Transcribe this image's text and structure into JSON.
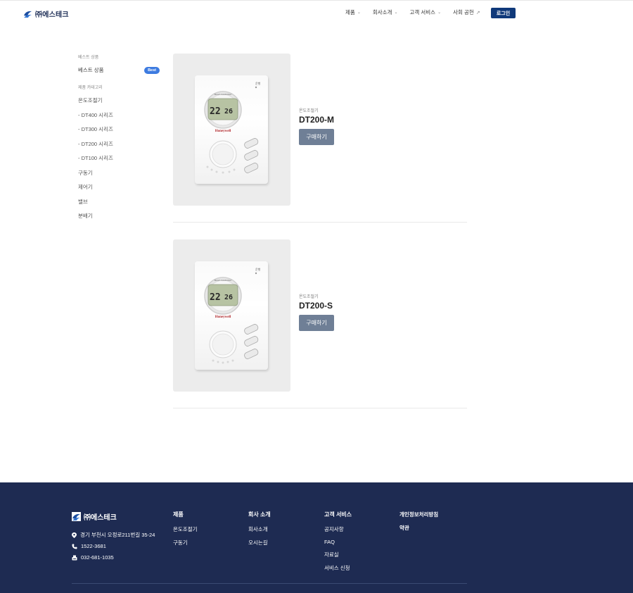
{
  "header": {
    "logo_text": "㈜에스테크",
    "nav": [
      {
        "label": "제품",
        "suffix": "⌄"
      },
      {
        "label": "회사소개",
        "suffix": "⌄"
      },
      {
        "label": "고객 서비스",
        "suffix": "⌄"
      },
      {
        "label": "사회 공헌",
        "suffix": "↗"
      }
    ],
    "login_label": "로그인"
  },
  "sidebar": {
    "best_section": "베스트 상품",
    "best_item": "베스트 상품",
    "best_badge": "Best",
    "category_section": "제품 카테고리",
    "items": [
      "온도조절기",
      "- DT400 시리즈",
      "- DT300 시리즈",
      "- DT200 시리즈",
      "- DT100 시리즈",
      "구동기",
      "제어기",
      "밸브",
      "분배기"
    ]
  },
  "products": [
    {
      "category": "온도조절기",
      "name": "DT200-M",
      "button": "구매하기",
      "brand": "Honeywell",
      "model_variant": "M"
    },
    {
      "category": "온도조절기",
      "name": "DT200-S",
      "button": "구매하기",
      "brand": "Honeywell",
      "model_variant": "S"
    }
  ],
  "thermostat_display": {
    "left": "22",
    "right": "26",
    "unit": "°C",
    "top_label": "Room Controller"
  },
  "footer": {
    "logo_text": "㈜에스테크",
    "address": "경기 부천시 오정로211번길 35-24",
    "phone": "1522-3681",
    "fax": "032-681-1035",
    "columns": [
      {
        "title": "제품",
        "links": [
          "온도조절기",
          "구동기"
        ]
      },
      {
        "title": "회사 소개",
        "links": [
          "회사소개",
          "오시는길"
        ]
      },
      {
        "title": "고객 서비스",
        "links": [
          "공지사항",
          "FAQ",
          "자료실",
          "서비스 신청"
        ]
      }
    ],
    "policies": [
      "개인정보처리방침",
      "약관"
    ]
  },
  "colors": {
    "accent": "#10397a",
    "footer_bg": "#1e2b52",
    "button_gray": "#6f7f96",
    "badge_blue": "#3d7be0"
  }
}
